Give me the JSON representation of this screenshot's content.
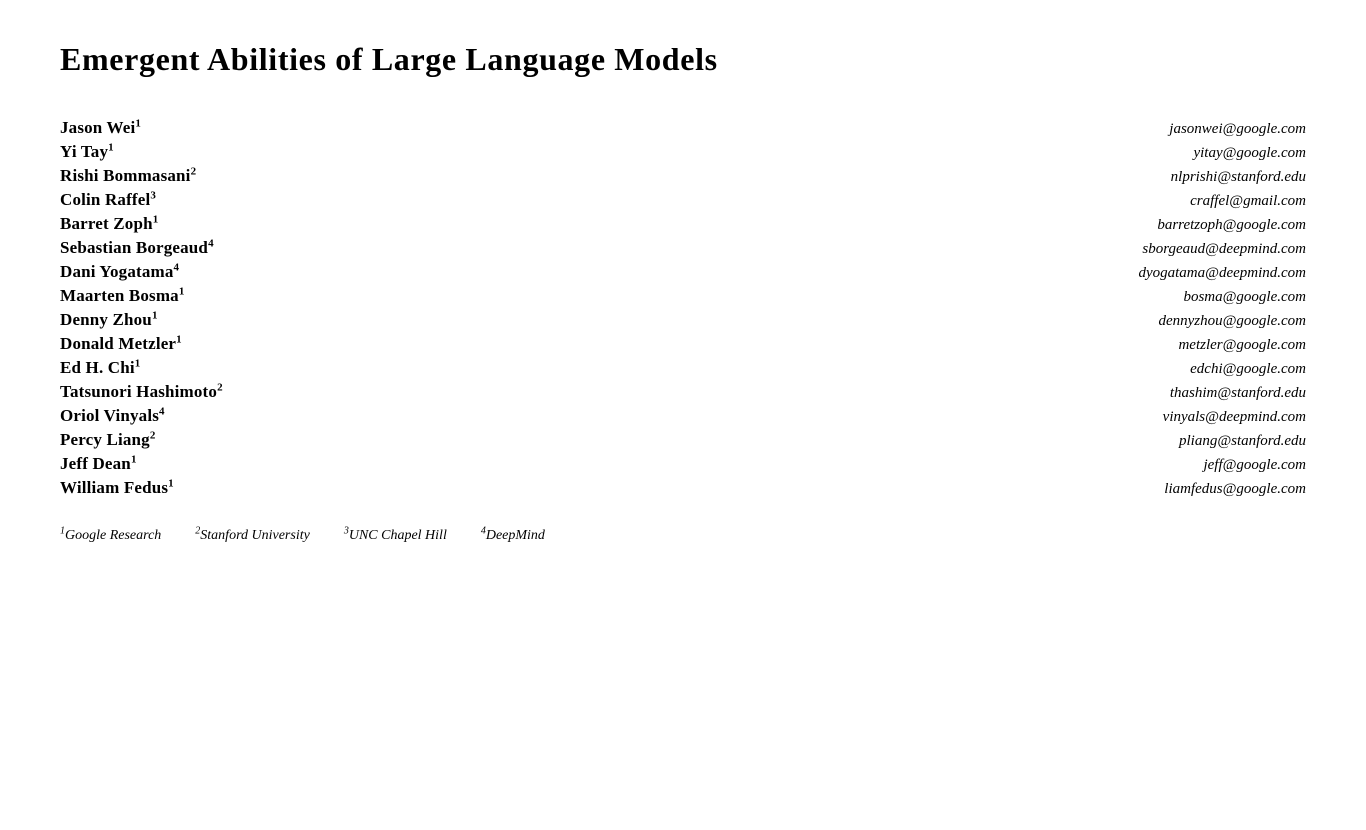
{
  "title": "Emergent Abilities of Large Language Models",
  "authors": [
    {
      "name": "Jason Wei",
      "sup": "1",
      "email": "jasonwei@google.com"
    },
    {
      "name": "Yi Tay",
      "sup": "1",
      "email": "yitay@google.com"
    },
    {
      "name": "Rishi Bommasani",
      "sup": "2",
      "email": "nlprishi@stanford.edu"
    },
    {
      "name": "Colin Raffel",
      "sup": "3",
      "email": "craffel@gmail.com"
    },
    {
      "name": "Barret Zoph",
      "sup": "1",
      "email": "barretzoph@google.com"
    },
    {
      "name": "Sebastian Borgeaud",
      "sup": "4",
      "email": "sborgeaud@deepmind.com"
    },
    {
      "name": "Dani Yogatama",
      "sup": "4",
      "email": "dyogatama@deepmind.com"
    },
    {
      "name": "Maarten Bosma",
      "sup": "1",
      "email": "bosma@google.com"
    },
    {
      "name": "Denny Zhou",
      "sup": "1",
      "email": "dennyzhou@google.com"
    },
    {
      "name": "Donald Metzler",
      "sup": "1",
      "email": "metzler@google.com"
    },
    {
      "name": "Ed H. Chi",
      "sup": "1",
      "email": "edchi@google.com"
    },
    {
      "name": "Tatsunori Hashimoto",
      "sup": "2",
      "email": "thashim@stanford.edu"
    },
    {
      "name": "Oriol Vinyals",
      "sup": "4",
      "email": "vinyals@deepmind.com"
    },
    {
      "name": "Percy Liang",
      "sup": "2",
      "email": "pliang@stanford.edu"
    },
    {
      "name": "Jeff Dean",
      "sup": "1",
      "email": "jeff@google.com"
    },
    {
      "name": "William Fedus",
      "sup": "1",
      "email": "liamfedus@google.com"
    }
  ],
  "affiliations": [
    {
      "sup": "1",
      "name": "Google Research"
    },
    {
      "sup": "2",
      "name": "Stanford University"
    },
    {
      "sup": "3",
      "name": "UNC Chapel Hill"
    },
    {
      "sup": "4",
      "name": "DeepMind"
    }
  ]
}
